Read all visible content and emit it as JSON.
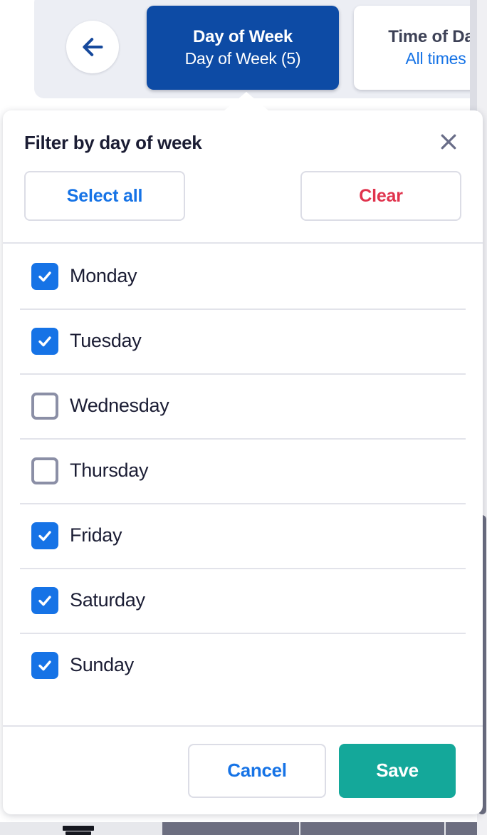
{
  "toolbar": {
    "back_icon": "arrow-left-icon",
    "chips": [
      {
        "title": "Day of Week",
        "subtitle": "Day of Week (5)",
        "active": true
      },
      {
        "title": "Time of Day",
        "subtitle": "All times",
        "active": false
      }
    ]
  },
  "popover": {
    "title": "Filter by day of week",
    "close_icon": "close-icon",
    "select_all_label": "Select all",
    "clear_label": "Clear",
    "items": [
      {
        "label": "Monday",
        "checked": true
      },
      {
        "label": "Tuesday",
        "checked": true
      },
      {
        "label": "Wednesday",
        "checked": false
      },
      {
        "label": "Thursday",
        "checked": false
      },
      {
        "label": "Friday",
        "checked": true
      },
      {
        "label": "Saturday",
        "checked": true
      },
      {
        "label": "Sunday",
        "checked": true
      }
    ],
    "cancel_label": "Cancel",
    "save_label": "Save"
  },
  "colors": {
    "accent_blue": "#1673e6",
    "tab_blue": "#0d4ba5",
    "danger_red": "#e0334d",
    "save_teal": "#14a89a",
    "panel_gray": "#eceef4",
    "text_dark": "#1b1d34"
  }
}
